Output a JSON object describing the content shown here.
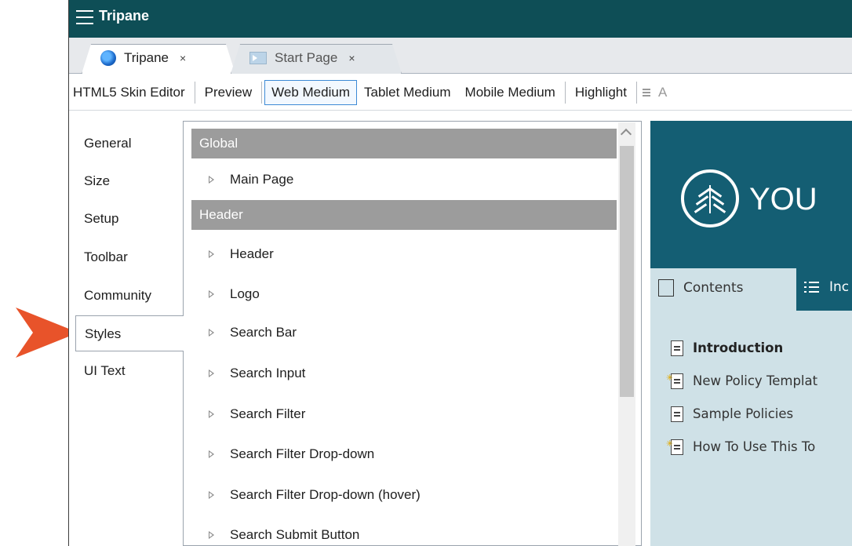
{
  "window": {
    "title": "Tripane"
  },
  "tabs": [
    {
      "label": "Tripane",
      "close": "×",
      "active": true
    },
    {
      "label": "Start Page",
      "close": "×",
      "active": false
    }
  ],
  "toolbar": {
    "items": [
      "HTML5 Skin Editor",
      "Preview",
      "Web Medium",
      "Tablet Medium",
      "Mobile Medium",
      "Highlight",
      "A"
    ],
    "active": "Web Medium"
  },
  "left_nav": {
    "items": [
      "General",
      "Size",
      "Setup",
      "Toolbar",
      "Community",
      "Styles",
      "UI Text"
    ],
    "selected": "Styles"
  },
  "style_list": {
    "sections": [
      {
        "title": "Global",
        "items": [
          "Main Page"
        ]
      },
      {
        "title": "Header",
        "items": [
          "Header",
          "Logo",
          "Search Bar",
          "Search Input",
          "Search Filter",
          "Search Filter Drop-down",
          "Search Filter Drop-down (hover)",
          "Search Submit Button"
        ]
      }
    ]
  },
  "preview": {
    "logo_text": "YOU",
    "tabs": {
      "contents": "Contents",
      "index": "Inc"
    },
    "toc": [
      {
        "label": "Introduction",
        "bold": true,
        "new": false
      },
      {
        "label": "New Policy Templat",
        "bold": false,
        "new": true
      },
      {
        "label": "Sample Policies",
        "bold": false,
        "new": false
      },
      {
        "label": "How To Use This To",
        "bold": false,
        "new": true
      }
    ]
  },
  "colors": {
    "titlebar": "#0e4e56",
    "preview_header": "#145e73",
    "preview_body": "#cfe1e7",
    "section_header": "#9c9c9c",
    "callout_arrow": "#e8532a"
  }
}
